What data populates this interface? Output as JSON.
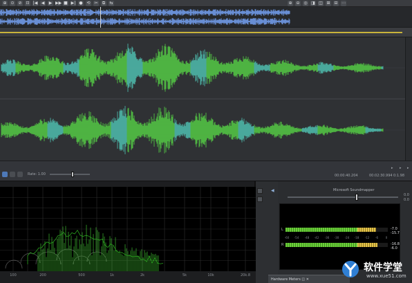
{
  "toolbar": {
    "buttons": [
      "⊕",
      "⊙",
      "⊘",
      "⊡",
      "|◀",
      "◀",
      "▶",
      "▶▶",
      "■",
      "▶|",
      "●",
      "⟲",
      "✂",
      "⧉",
      "⇆",
      "⊕",
      "⊖",
      "◎",
      "◨",
      "◫",
      "⊞",
      "⊟",
      "⋯"
    ]
  },
  "statusbar": {
    "rate_label": "Rate: 1.00",
    "time_start": "00:00:40.204",
    "time_end": "00:02:30.994",
    "duration": "0:1.98"
  },
  "spectrum": {
    "freq_ticks": [
      "100",
      "200",
      "500",
      "1k",
      "2k",
      "5k",
      "10k",
      "20k.8"
    ]
  },
  "meters": {
    "title": "Microsoft Soundmapper",
    "right_top_vals": [
      "0.0",
      "0.0"
    ],
    "channels": [
      {
        "label": "L",
        "level_db": -7.0,
        "peak_text": "-7.0",
        "peak2_text": "-15.7"
      },
      {
        "label": "R",
        "level_db": -6.0,
        "peak_text": "-16.8",
        "peak2_text": "-6.0"
      }
    ],
    "scale": [
      "-60",
      "-54",
      "-48",
      "-42",
      "-36",
      "-30",
      "-24",
      "-18",
      "-12",
      "-6",
      "0"
    ],
    "tab_label": "Hardware Meters ◫ ✕"
  },
  "watermark": {
    "cn": "软件学堂",
    "url": "www.xue51.com"
  },
  "colors": {
    "wave_green": "#53c244",
    "wave_cyan": "#4db6a8",
    "overview_blue": "#7aa8ff",
    "yellow_bar": "#c9b43a",
    "spectrum_green": "#3fbf2f"
  }
}
